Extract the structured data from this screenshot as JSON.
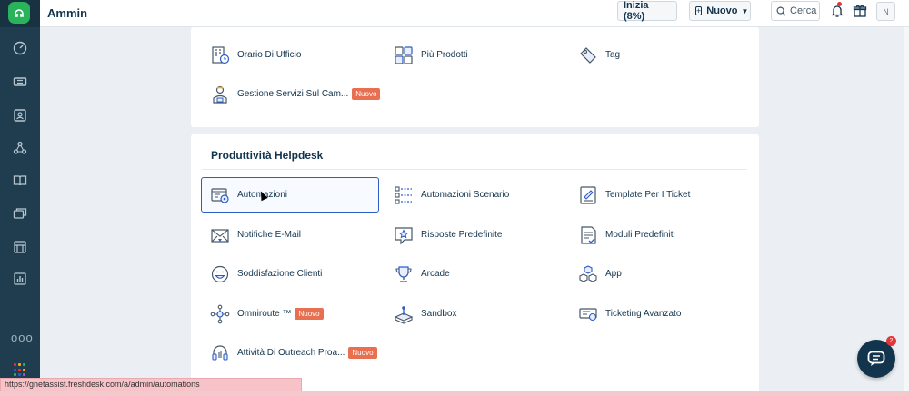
{
  "header": {
    "title": "Ammin",
    "start_button": "Inizia (8%)",
    "new_button": "Nuovo",
    "search_label": "Cerca",
    "avatar_initial": "N",
    "notification_dot_color": "#e43538"
  },
  "sidebar": {
    "items": [
      "dashboard-icon",
      "tickets-icon",
      "contacts-icon",
      "groups-icon",
      "knowledge-base-icon",
      "forums-icon",
      "marketplace-icon",
      "reports-icon"
    ],
    "more_label": "ooo"
  },
  "top_section": {
    "items": [
      {
        "label": "Orario Di Ufficio",
        "icon": "office-hours-icon"
      },
      {
        "label": "Più Prodotti",
        "icon": "multiple-products-icon"
      },
      {
        "label": "Tag",
        "icon": "tag-icon"
      },
      {
        "label": "Gestione Servizi Sul Cam...",
        "icon": "field-service-icon",
        "badge": "Nuovo"
      }
    ]
  },
  "helpdesk_section": {
    "title": "Produttività Helpdesk",
    "items": [
      {
        "label": "Automazioni",
        "icon": "automations-icon",
        "active": true
      },
      {
        "label": "Automazioni Scenario",
        "icon": "scenario-automations-icon"
      },
      {
        "label": "Template Per I Ticket",
        "icon": "ticket-template-icon"
      },
      {
        "label": "Notifiche E-Mail",
        "icon": "email-notifications-icon"
      },
      {
        "label": "Risposte Predefinite",
        "icon": "canned-responses-icon"
      },
      {
        "label": "Moduli Predefiniti",
        "icon": "canned-forms-icon"
      },
      {
        "label": "Soddisfazione Clienti",
        "icon": "customer-satisfaction-icon"
      },
      {
        "label": "Arcade",
        "icon": "arcade-icon"
      },
      {
        "label": "App",
        "icon": "apps-icon"
      },
      {
        "label": "Omniroute ™",
        "icon": "omniroute-icon",
        "badge": "Nuovo"
      },
      {
        "label": "Sandbox",
        "icon": "sandbox-icon"
      },
      {
        "label": "Ticketing Avanzato",
        "icon": "advanced-ticketing-icon"
      },
      {
        "label": "Attività Di Outreach Proa...",
        "icon": "proactive-outreach-icon",
        "badge": "Nuovo"
      }
    ]
  },
  "chat_widget": {
    "badge_count": "2"
  },
  "status_bar": {
    "url": "https://gnetassist.freshdesk.com/a/admin/automations"
  },
  "colors": {
    "sidebar": "#1f3d4f",
    "accent": "#2c5cc5",
    "badge": "#e86f4f",
    "logo": "#29b35a"
  }
}
